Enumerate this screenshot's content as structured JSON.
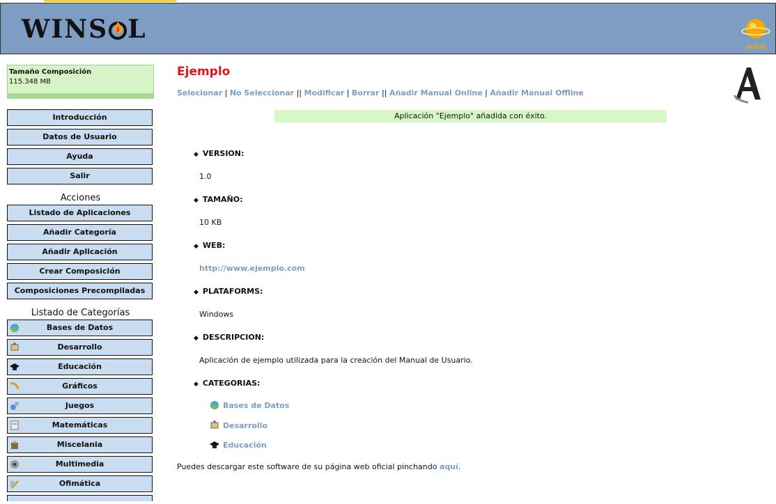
{
  "header": {
    "logo_text": "WINSOL",
    "brand_right": "orisol"
  },
  "sidebar": {
    "size_label": "Tamaño Composición",
    "size_value": "115.348 MB",
    "nav": [
      "Introducción",
      "Datos de Usuario",
      "Ayuda",
      "Salir"
    ],
    "actions_title": "Acciones",
    "actions": [
      "Listado de Aplicaciones",
      "Añadir Categoría",
      "Añadir Aplicación",
      "Crear Composición",
      "Composiciones Precompiladas"
    ],
    "categories_title": "Listado de Categorías",
    "categories": [
      {
        "label": "Bases de Datos",
        "icon": "database-icon"
      },
      {
        "label": "Desarrollo",
        "icon": "development-icon"
      },
      {
        "label": "Educación",
        "icon": "graduation-cap-icon"
      },
      {
        "label": "Gráficos",
        "icon": "graphics-icon"
      },
      {
        "label": "Juegos",
        "icon": "games-icon"
      },
      {
        "label": "Matemáticas",
        "icon": "math-icon"
      },
      {
        "label": "Miscelania",
        "icon": "misc-icon"
      },
      {
        "label": "Multimedia",
        "icon": "multimedia-icon"
      },
      {
        "label": "Ofimática",
        "icon": "office-icon"
      }
    ]
  },
  "main": {
    "title": "Ejemplo",
    "actions": {
      "select": "Selecionar",
      "deselect": "No Seleccionar",
      "modify": "Modificar",
      "delete": "Borrar",
      "add_online": "Añadir Manual Online",
      "add_offline": "Añadir Manual Offline"
    },
    "success_message": "Aplicación \"Ejemplo\" añadida con éxito.",
    "fields": {
      "version_label": "VERSION:",
      "version_value": "1.0",
      "size_label": "TAMAÑO:",
      "size_value": "10 KB",
      "web_label": "WEB:",
      "web_value": "http://www.ejemplo.com",
      "platforms_label": "PLATAFORMS:",
      "platforms_value": "Windows",
      "description_label": "DESCRIPCION:",
      "description_value": "Aplicación de ejemplo utilizada para la creación del Manual de Usuario.",
      "categories_label": "CATEGORIAS:"
    },
    "app_categories": [
      {
        "label": "Bases de Datos",
        "icon": "database-icon"
      },
      {
        "label": "Desarrollo",
        "icon": "development-icon"
      },
      {
        "label": "Educación",
        "icon": "graduation-cap-icon"
      }
    ],
    "footer_text": "Puedes descargar este software de su página web oficial pinchando",
    "footer_link": "aquí",
    "footer_end": "."
  },
  "colors": {
    "header_bg": "#7e9dc3",
    "button_bg": "#cadcef",
    "title_red": "#e0141b",
    "success_bg": "#d6f8c6",
    "link": "#7e9dc3"
  }
}
